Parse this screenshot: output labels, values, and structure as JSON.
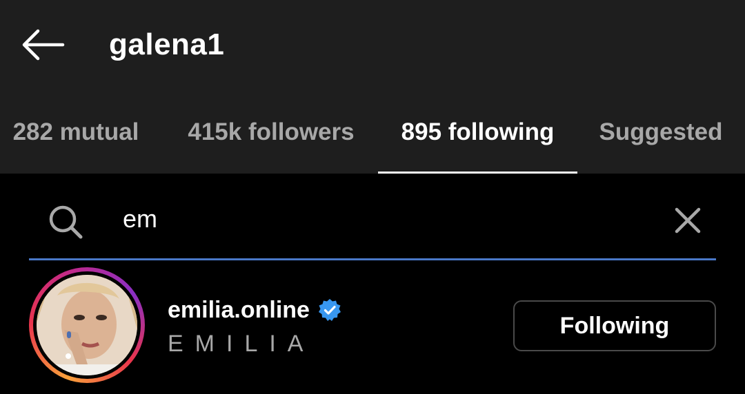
{
  "header": {
    "title": "galena1",
    "back_icon": "arrow-left-icon"
  },
  "tabs": [
    {
      "label": "282 mutual",
      "active": false
    },
    {
      "label": "415k followers",
      "active": false
    },
    {
      "label": "895 following",
      "active": true
    },
    {
      "label": "Suggested",
      "active": false
    }
  ],
  "search": {
    "value": "em",
    "search_icon": "search-icon",
    "clear_icon": "close-icon"
  },
  "results": [
    {
      "username": "emilia.online",
      "verified": true,
      "full_name": "EMILIA",
      "button_label": "Following"
    }
  ],
  "colors": {
    "header_bg": "#1e1e1e",
    "page_bg": "#000000",
    "accent_underline": "#4a78c8",
    "verified_blue": "#3897f0",
    "muted_text": "#a8a8a8"
  }
}
